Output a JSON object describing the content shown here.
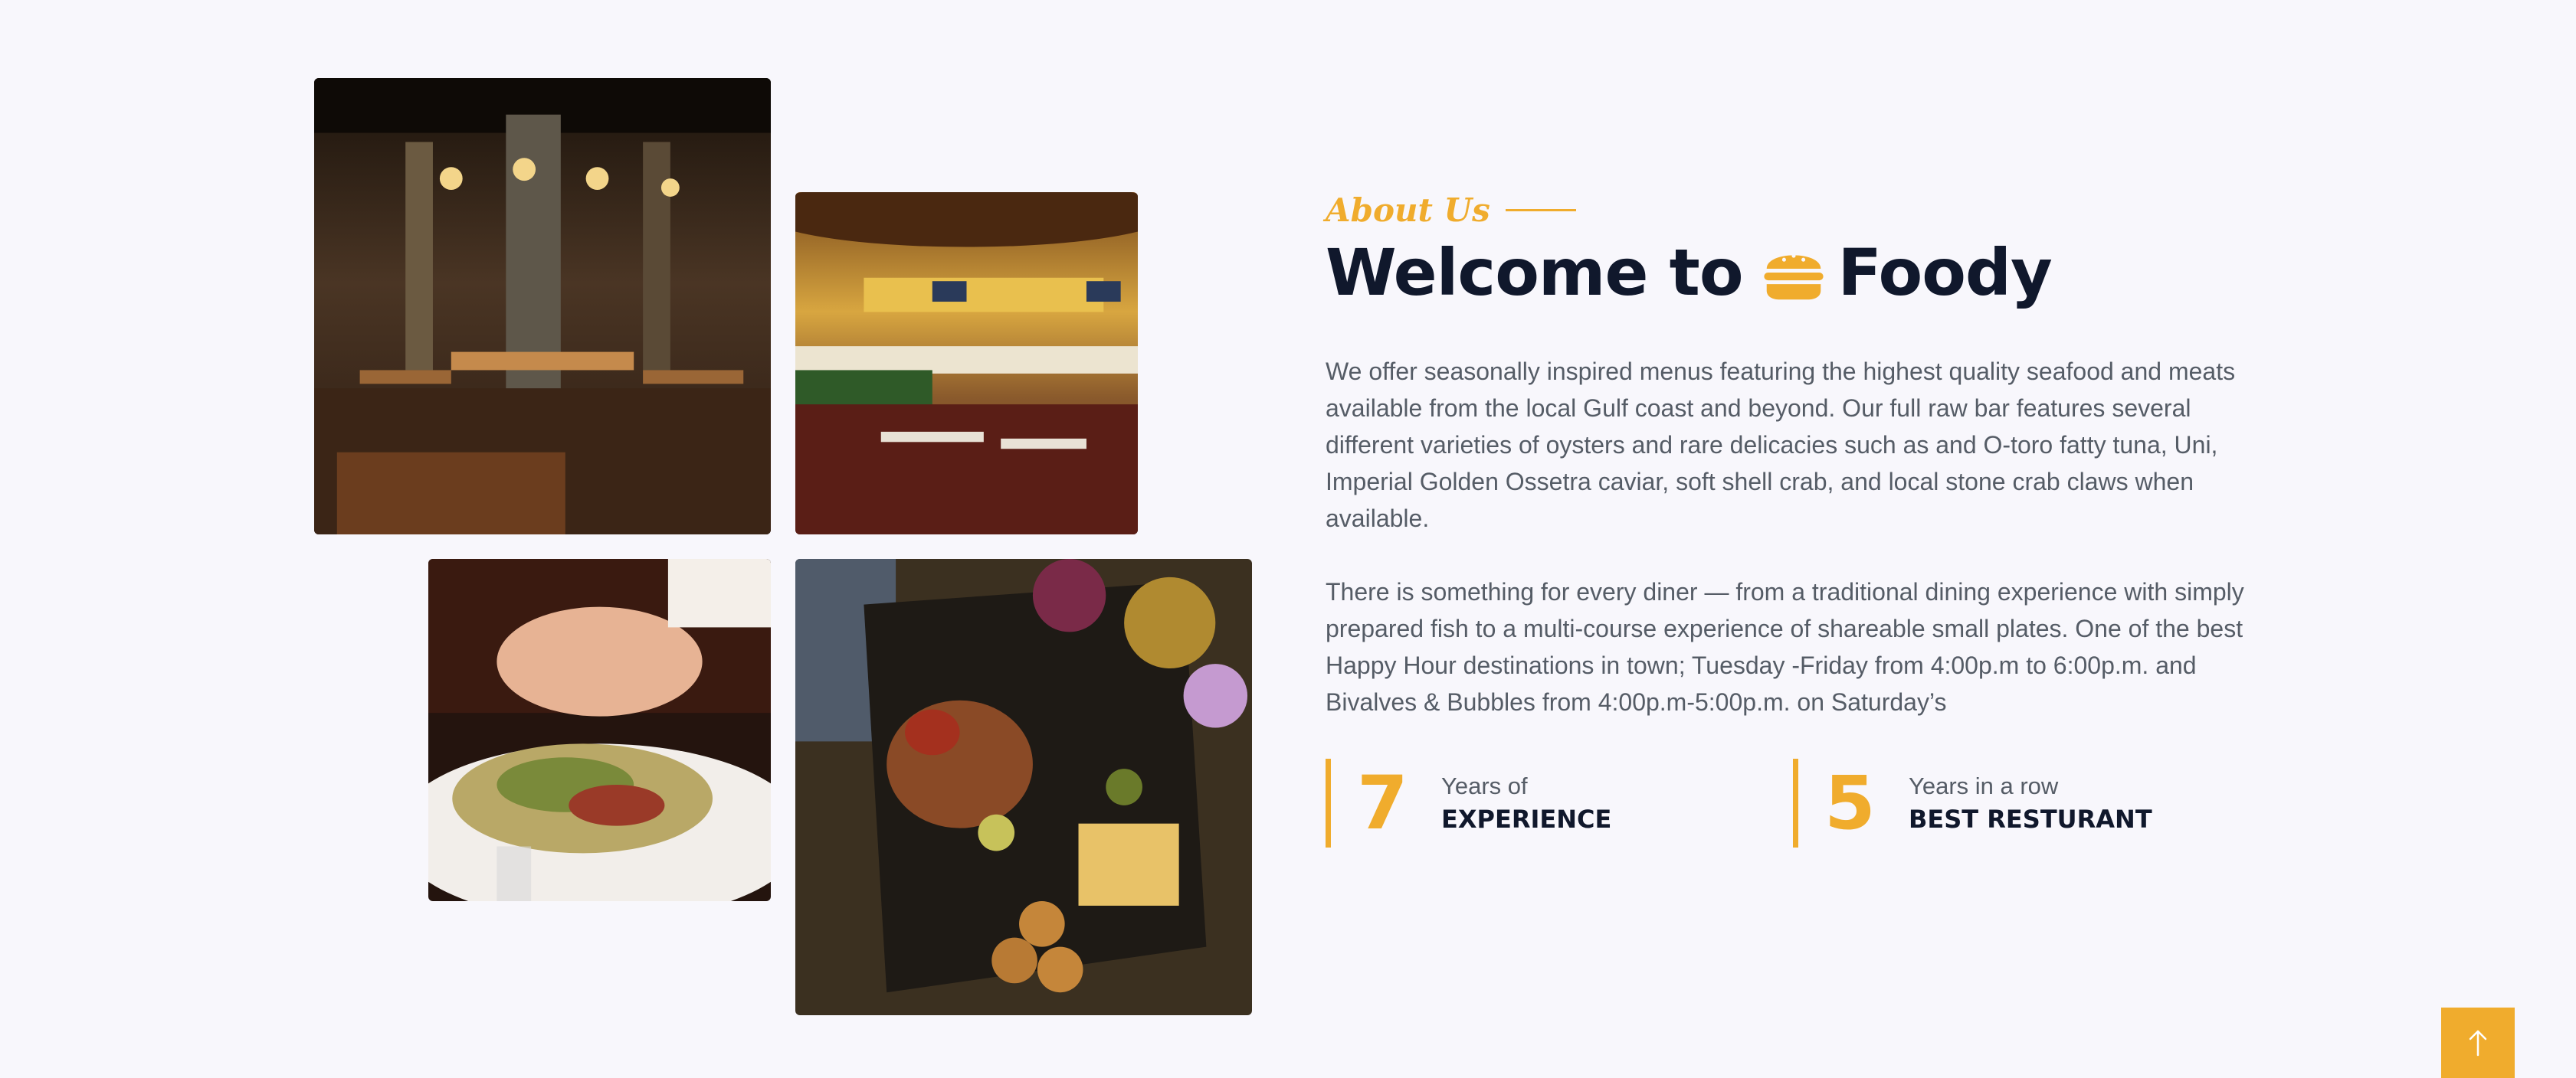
{
  "about": {
    "eyebrow": "About Us",
    "heading_before": "Welcome to",
    "heading_after": "Foody",
    "paragraph_1": "We offer seasonally inspired menus featuring the highest quality seafood and meats available from the local Gulf coast and beyond. Our full raw bar features several different varieties of oysters and rare delicacies such as and O-toro fatty tuna, Uni, Imperial Golden Ossetra caviar, soft shell crab, and local stone crab claws when available.",
    "paragraph_2": "There is something for every diner — from a traditional dining experience with simply prepared fish to a multi-course experience of shareable small plates. One of the best Happy Hour destinations in town; Tuesday -Friday from 4:00p.m to 6:00p.m. and Bivalves & Bubbles from 4:00p.m-5:00p.m. on Saturday’s"
  },
  "stats": [
    {
      "number": "7",
      "top": "Years of",
      "bottom": "EXPERIENCE"
    },
    {
      "number": "5",
      "top": "Years in a row",
      "bottom": "BEST RESTURANT"
    }
  ],
  "icons": {
    "heading_icon": "burger-icon",
    "back_to_top_icon": "arrow-up-icon"
  },
  "colors": {
    "accent": "#f0ac2d",
    "heading": "#10182c",
    "body_text": "#555c66",
    "background": "#f8f7fc"
  }
}
